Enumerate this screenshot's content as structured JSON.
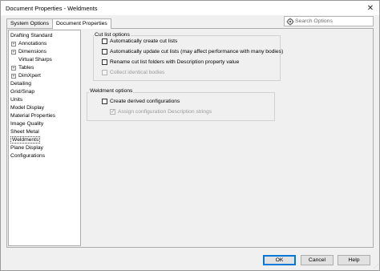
{
  "window": {
    "title": "Document Properties - Weldments"
  },
  "tabs": [
    {
      "label": "System Options",
      "active": false
    },
    {
      "label": "Document Properties",
      "active": true
    }
  ],
  "search": {
    "placeholder": "Search Options",
    "icon": "gear-search-icon"
  },
  "tree": {
    "items": [
      {
        "label": "Drafting Standard"
      },
      {
        "label": "Annotations",
        "expandable": true
      },
      {
        "label": "Dimensions",
        "expandable": true
      },
      {
        "label": "Virtual Sharps"
      },
      {
        "label": "Tables",
        "expandable": true
      },
      {
        "label": "DimXpert",
        "expandable": true
      },
      {
        "label": "Detailing"
      },
      {
        "label": "Grid/Snap"
      },
      {
        "label": "Units"
      },
      {
        "label": "Model Display"
      },
      {
        "label": "Material Properties"
      },
      {
        "label": "Image Quality"
      },
      {
        "label": "Sheet Metal"
      },
      {
        "label": "Weldments",
        "selected": true
      },
      {
        "label": "Plane Display"
      },
      {
        "label": "Configurations"
      }
    ]
  },
  "cut_list": {
    "title": "Cut list options",
    "options": [
      {
        "label": "Automatically create cut lists",
        "checked": false,
        "enabled": true
      },
      {
        "label": "Automatically update cut lists (may affect performance with many bodies)",
        "checked": false,
        "enabled": true
      },
      {
        "label": "Rename cut list folders with Description property value",
        "checked": false,
        "enabled": true
      },
      {
        "label": "Collect identical bodies",
        "checked": false,
        "enabled": false
      }
    ]
  },
  "weldment": {
    "title": "Weldment options",
    "options": [
      {
        "label": "Create derived configurations",
        "checked": false,
        "enabled": true
      },
      {
        "label": "Assign configuration Description strings",
        "checked": true,
        "enabled": false
      }
    ]
  },
  "buttons": {
    "ok": "OK",
    "cancel": "Cancel",
    "help": "Help"
  }
}
